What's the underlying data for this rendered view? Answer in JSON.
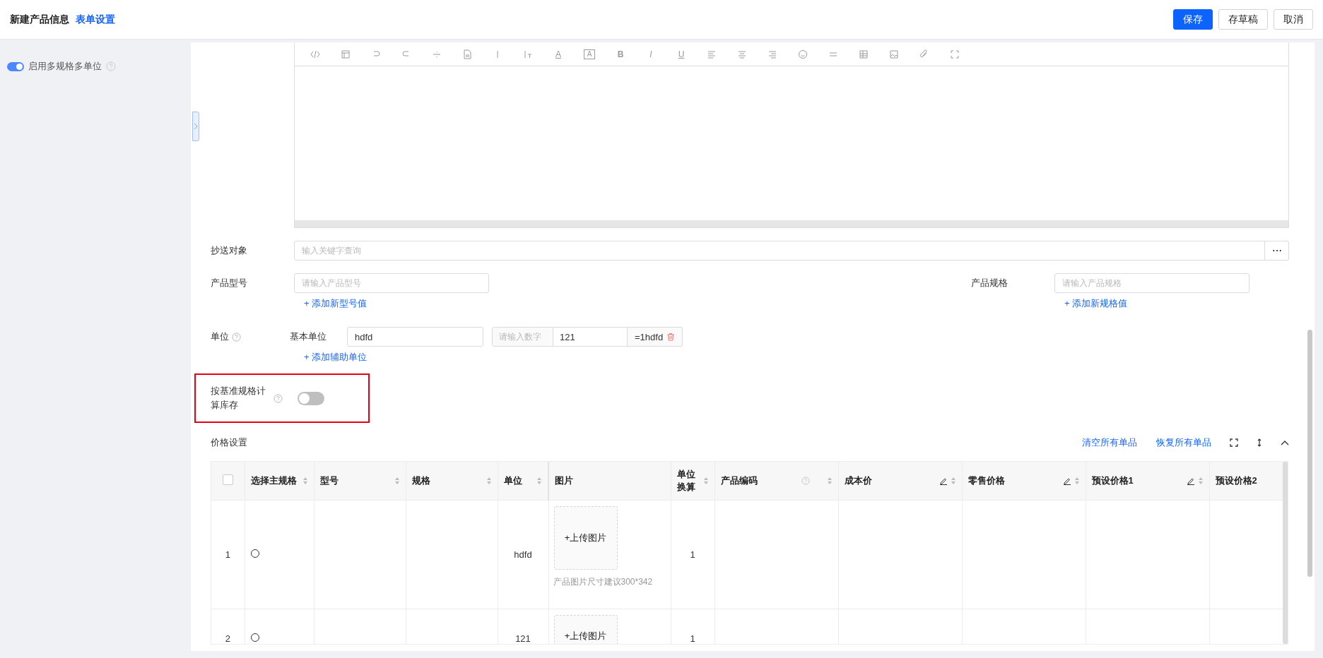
{
  "header": {
    "title": "新建产品信息",
    "settings_link": "表单设置",
    "buttons": [
      {
        "label": "保存",
        "kind": "primary"
      },
      {
        "label": "存草稿",
        "kind": "default"
      },
      {
        "label": "取消",
        "kind": "default"
      }
    ]
  },
  "sidebar": {
    "toggle": {
      "label": "启用多规格多单位",
      "on": true
    }
  },
  "editor": {
    "glyphs": [
      "A",
      "A",
      "B",
      "I",
      "U"
    ]
  },
  "form": {
    "cc": {
      "label": "抄送对象",
      "placeholder": "输入关键字查询",
      "more": "⋯"
    },
    "model": {
      "label": "产品型号",
      "placeholder": "请输入产品型号",
      "add_link": "+ 添加新型号值"
    },
    "spec": {
      "label": "产品规格",
      "placeholder": "请输入产品规格",
      "add_link": "+ 添加新规格值"
    },
    "unit": {
      "label": "单位",
      "base_label": "基本单位",
      "base_value": "hdfd",
      "ratio_placeholder": "请输入数字",
      "ratio_value": "121",
      "ratio_result": "=1hdfd",
      "add_link": "+ 添加辅助单位"
    },
    "stock": {
      "label": "按基准规格计算库存",
      "on": false,
      "highlighted": true
    }
  },
  "price": {
    "title": "价格设置",
    "actions": [
      "清空所有单品",
      "恢复所有单品"
    ],
    "table": {
      "select_all": {
        "checked": false
      },
      "columns": [
        {
          "label": "选择主规格",
          "sortable": true,
          "editable": false,
          "help": false
        },
        {
          "label": "型号",
          "sortable": true,
          "editable": false,
          "help": false
        },
        {
          "label": "规格",
          "sortable": true,
          "editable": false,
          "help": false
        },
        {
          "label": "单位",
          "sortable": true,
          "editable": false,
          "help": false
        },
        {
          "label": "图片",
          "sortable": false,
          "editable": false,
          "help": false
        },
        {
          "label": "单位换算",
          "sortable": true,
          "editable": false,
          "help": false
        },
        {
          "label": "产品编码",
          "sortable": true,
          "editable": false,
          "help": true
        },
        {
          "label": "成本价",
          "sortable": true,
          "editable": true,
          "help": false
        },
        {
          "label": "零售价格",
          "sortable": true,
          "editable": true,
          "help": false
        },
        {
          "label": "预设价格1",
          "sortable": true,
          "editable": true,
          "help": false
        },
        {
          "label": "预设价格2",
          "sortable": false,
          "editable": false,
          "help": false
        }
      ],
      "rows": [
        {
          "index": "1",
          "selected": false,
          "unit": "hdfd",
          "upload": "+上传图片",
          "hint": "产品图片尺寸建议300*342",
          "conversion": "1"
        },
        {
          "index": "2",
          "selected": false,
          "unit": "121",
          "upload": "+上传图片",
          "conversion": "1"
        }
      ]
    }
  }
}
